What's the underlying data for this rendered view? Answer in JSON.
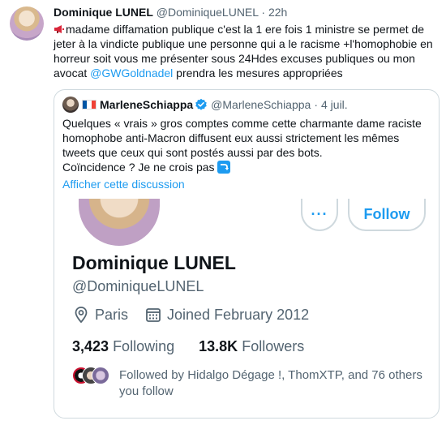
{
  "tweet": {
    "author_name": "Dominique LUNEL",
    "author_handle": "@DominiqueLUNEL",
    "separator": "·",
    "time": "22h",
    "text_before_mention": "madame diffamation publique c'est la 1 ere fois 1 ministre se permet de jeter à la vindicte publique une personne qui a le racisme +l'homophobie en horreur soit vous me présenter sous 24Hdes excuses publiques ou mon avocat ",
    "mention": "@GWGoldnadel",
    "text_after_mention": " prendra les mesures appropriées",
    "icons": {
      "avatar": "avatar-image",
      "megaphone": "megaphone-icon"
    }
  },
  "quote": {
    "author_name": "MarleneSchiappa",
    "author_handle": "@MarleneSchiappa",
    "separator": "·",
    "date": "4 juil.",
    "text": "Quelques « vrais » gros comptes comme cette charmante dame raciste homophobe anti-Macron diffusent eux aussi strictement les mêmes tweets que ceux qui sont postés aussi par des bots.",
    "text_line2": "Coïncidence ? Je ne crois pas",
    "show_thread": "Afficher cette discussion",
    "icons": {
      "flag": "france-flag-icon",
      "verified": "verified-badge-icon",
      "emoji": "right-arrow-curving-down-emoji"
    }
  },
  "profile_card": {
    "more_label": "···",
    "follow_label": "Follow",
    "name": "Dominique LUNEL",
    "handle": "@DominiqueLUNEL",
    "location": "Paris",
    "joined": "Joined February 2012",
    "following_count": "3,423",
    "following_label": "Following",
    "followers_count": "13.8K",
    "followers_label": "Followers",
    "followed_by": "Followed by Hidalgo Dégage !, ThomXTP, and 76 others you follow",
    "icons": {
      "location": "location-pin-icon",
      "calendar": "calendar-icon"
    }
  },
  "colors": {
    "accent": "#1d9bf0",
    "text": "#0f1419",
    "muted": "#536471",
    "border": "#cfd9de"
  }
}
